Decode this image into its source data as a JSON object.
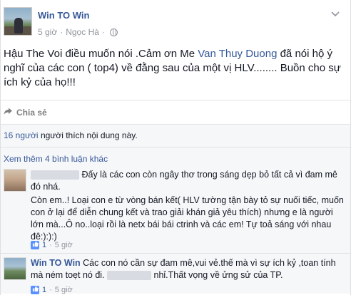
{
  "post": {
    "author": "Win TO Win",
    "time": "5 giờ",
    "separator": "·",
    "location": "Ngọc Hà",
    "text_before_mention": "Hậu The Voi điều muốn nói .Cảm ơn Me ",
    "mention": "Van Thuy Duong",
    "text_after_mention": " đã nói hộ ý nghĩ của các con ( top4) về đằng sau của một vị HLV........ Buồn cho sự ích kỷ của họ!!!"
  },
  "actions": {
    "share_label": "Chia sẻ",
    "share_icon": "share-arrow-icon"
  },
  "feedback": {
    "likes_count": "16 người",
    "likes_text": " người thích nội dung này.",
    "view_more": "Xem thêm 4 bình luận khác"
  },
  "comments": [
    {
      "author": "",
      "text_line1": "Đấy là các con còn ngây thơ trong sáng dẹp bỏ tất cả vì đam mê đó nhá.",
      "text_line2": "Còn em..! Loại con e từ vòng bán kết( HLV tường tận bày tỏ sự nuối tiếc, muốn con ở lại để diễn chung kết và trao giải khán giả yêu thích) nhưng e là người lớn mà...Ô no..loại rồi là netx bái bái ctrinh và các em! Tự toả sáng với nhau đê:):):)",
      "likes": "1",
      "time": "5 giờ"
    },
    {
      "author": "Win TO Win",
      "text_part1": "Các con nó cần sự đam mê,vui vẻ.thế mà vì sự ích kỷ ,toan tính mà ném toẹt nó đi. ",
      "text_part2": " nhỉ.Thất vọng về ửng sử của TP.",
      "likes": "1",
      "time": "5 giờ"
    }
  ],
  "colors": {
    "link": "#365899",
    "meta": "#90949c",
    "feedback_bg": "#f6f7f9"
  }
}
